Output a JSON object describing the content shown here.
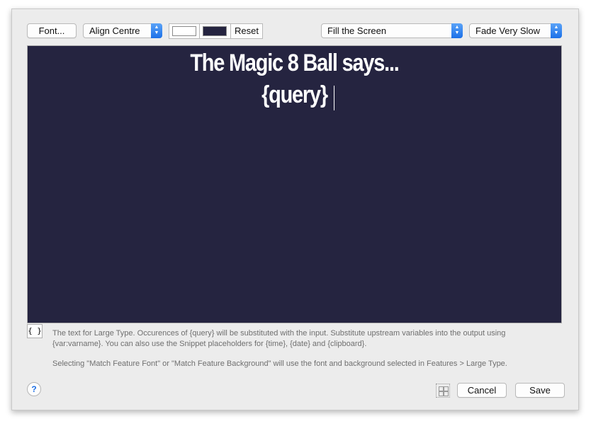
{
  "toolbar": {
    "font_button": "Font...",
    "align_popup": "Align Centre",
    "text_color": "#ffffff",
    "background_color": "#252440",
    "reset_button": "Reset",
    "fill_popup": "Fill the Screen",
    "fade_popup": "Fade Very Slow"
  },
  "preview": {
    "line1": "The Magic 8 Ball says...",
    "line2": "{query}"
  },
  "editor": {
    "placeholders_button": "{ }",
    "help_text_1": "The text for Large Type. Occurences of {query} will be substituted with the input. Substitute upstream variables into the output using {var:varname}. You can also use the Snippet placeholders for {time}, {date} and {clipboard}.",
    "help_text_2": "Selecting \"Match Feature Font\" or \"Match Feature Background\" will use the font and background selected in Features > Large Type."
  },
  "footer": {
    "help_button": "?",
    "cancel_button": "Cancel",
    "save_button": "Save"
  }
}
